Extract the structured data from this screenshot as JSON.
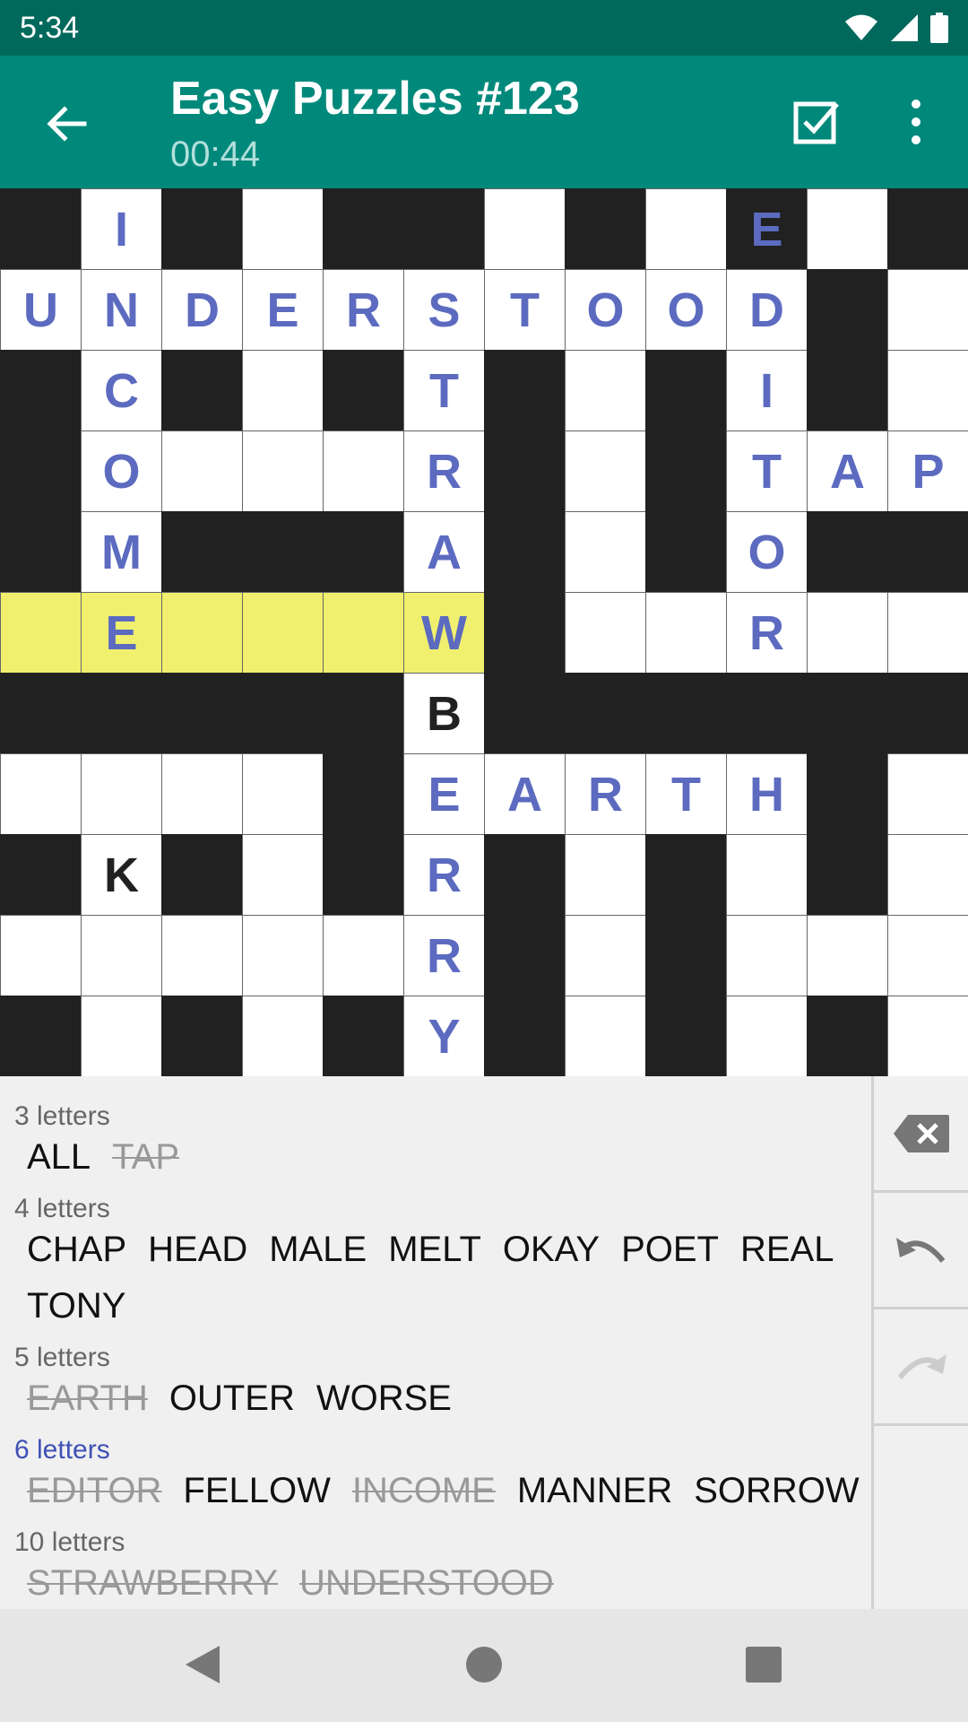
{
  "status_bar": {
    "time": "5:34",
    "icons": [
      "wifi-icon",
      "signal-icon",
      "battery-icon"
    ]
  },
  "app_bar": {
    "title": "Easy Puzzles #123",
    "timer": "00:44",
    "icons": [
      "back-arrow-icon",
      "check-box-icon",
      "more-vertical-icon"
    ]
  },
  "colors": {
    "status_bar": "#00695c",
    "app_bar": "#00897b",
    "placed_letter": "#5c6bc0",
    "highlight": "#f0f06e",
    "black_cell": "#212121"
  },
  "grid": {
    "rows": 11,
    "cols": 12,
    "highlight_row": 5,
    "highlight_cols": [
      0,
      5
    ],
    "layout": [
      "#.#.##.#.#.",
      "..........#.",
      "#.#.#.#.#.#.",
      "#.....#.#...",
      "#.###.#.#.##",
      "......#.....",
      "#####.######",
      "....#.....#.",
      "#.#.#.#.#.#.",
      "......#.#...",
      "#.#.#.#.#.#."
    ],
    "letters": [
      {
        "r": 0,
        "c": 1,
        "ch": "I",
        "kind": "placed"
      },
      {
        "r": 0,
        "c": 9,
        "ch": "E",
        "kind": "placed"
      },
      {
        "r": 1,
        "c": 0,
        "ch": "U",
        "kind": "placed"
      },
      {
        "r": 1,
        "c": 1,
        "ch": "N",
        "kind": "placed"
      },
      {
        "r": 1,
        "c": 2,
        "ch": "D",
        "kind": "placed"
      },
      {
        "r": 1,
        "c": 3,
        "ch": "E",
        "kind": "placed"
      },
      {
        "r": 1,
        "c": 4,
        "ch": "R",
        "kind": "placed"
      },
      {
        "r": 1,
        "c": 5,
        "ch": "S",
        "kind": "placed"
      },
      {
        "r": 1,
        "c": 6,
        "ch": "T",
        "kind": "placed"
      },
      {
        "r": 1,
        "c": 7,
        "ch": "O",
        "kind": "placed"
      },
      {
        "r": 1,
        "c": 8,
        "ch": "O",
        "kind": "placed"
      },
      {
        "r": 1,
        "c": 9,
        "ch": "D",
        "kind": "placed"
      },
      {
        "r": 2,
        "c": 1,
        "ch": "C",
        "kind": "placed"
      },
      {
        "r": 2,
        "c": 5,
        "ch": "T",
        "kind": "placed"
      },
      {
        "r": 2,
        "c": 9,
        "ch": "I",
        "kind": "placed"
      },
      {
        "r": 3,
        "c": 1,
        "ch": "O",
        "kind": "placed"
      },
      {
        "r": 3,
        "c": 5,
        "ch": "R",
        "kind": "placed"
      },
      {
        "r": 3,
        "c": 9,
        "ch": "T",
        "kind": "placed"
      },
      {
        "r": 3,
        "c": 10,
        "ch": "A",
        "kind": "placed"
      },
      {
        "r": 3,
        "c": 11,
        "ch": "P",
        "kind": "placed"
      },
      {
        "r": 4,
        "c": 1,
        "ch": "M",
        "kind": "placed"
      },
      {
        "r": 4,
        "c": 5,
        "ch": "A",
        "kind": "placed"
      },
      {
        "r": 4,
        "c": 9,
        "ch": "O",
        "kind": "placed"
      },
      {
        "r": 5,
        "c": 1,
        "ch": "E",
        "kind": "placed"
      },
      {
        "r": 5,
        "c": 5,
        "ch": "W",
        "kind": "placed"
      },
      {
        "r": 5,
        "c": 9,
        "ch": "R",
        "kind": "placed"
      },
      {
        "r": 6,
        "c": 5,
        "ch": "B",
        "kind": "given"
      },
      {
        "r": 7,
        "c": 5,
        "ch": "E",
        "kind": "placed"
      },
      {
        "r": 7,
        "c": 6,
        "ch": "A",
        "kind": "placed"
      },
      {
        "r": 7,
        "c": 7,
        "ch": "R",
        "kind": "placed"
      },
      {
        "r": 7,
        "c": 8,
        "ch": "T",
        "kind": "placed"
      },
      {
        "r": 7,
        "c": 9,
        "ch": "H",
        "kind": "placed"
      },
      {
        "r": 8,
        "c": 1,
        "ch": "K",
        "kind": "given"
      },
      {
        "r": 8,
        "c": 5,
        "ch": "R",
        "kind": "placed"
      },
      {
        "r": 9,
        "c": 5,
        "ch": "R",
        "kind": "placed"
      },
      {
        "r": 10,
        "c": 5,
        "ch": "Y",
        "kind": "placed"
      }
    ]
  },
  "word_list": {
    "active_group": 3,
    "groups": [
      {
        "label": "3 letters",
        "lines": [
          [
            {
              "text": "ALL",
              "used": false
            },
            {
              "text": "TAP",
              "used": true
            }
          ]
        ]
      },
      {
        "label": "4 letters",
        "lines": [
          [
            {
              "text": "CHAP",
              "used": false
            },
            {
              "text": "HEAD",
              "used": false
            },
            {
              "text": "MALE",
              "used": false
            },
            {
              "text": "MELT",
              "used": false
            },
            {
              "text": "OKAY",
              "used": false
            },
            {
              "text": "POET",
              "used": false
            },
            {
              "text": "REAL",
              "used": false
            }
          ],
          [
            {
              "text": "TONY",
              "used": false
            }
          ]
        ]
      },
      {
        "label": "5 letters",
        "lines": [
          [
            {
              "text": "EARTH",
              "used": true
            },
            {
              "text": "OUTER",
              "used": false
            },
            {
              "text": "WORSE",
              "used": false
            }
          ]
        ]
      },
      {
        "label": "6 letters",
        "lines": [
          [
            {
              "text": "EDITOR",
              "used": true
            },
            {
              "text": "FELLOW",
              "used": false
            },
            {
              "text": "INCOME",
              "used": true
            },
            {
              "text": "MANNER",
              "used": false
            },
            {
              "text": "SORROW",
              "used": false
            }
          ]
        ]
      },
      {
        "label": "10 letters",
        "lines": [
          [
            {
              "text": "STRAWBERRY",
              "used": true
            },
            {
              "text": "UNDERSTOOD",
              "used": true
            }
          ]
        ]
      }
    ]
  },
  "side_actions": [
    {
      "name": "backspace-icon"
    },
    {
      "name": "undo-icon"
    },
    {
      "name": "redo-icon"
    }
  ],
  "nav_bar": {
    "icons": [
      "nav-back-icon",
      "nav-home-icon",
      "nav-recents-icon"
    ]
  }
}
